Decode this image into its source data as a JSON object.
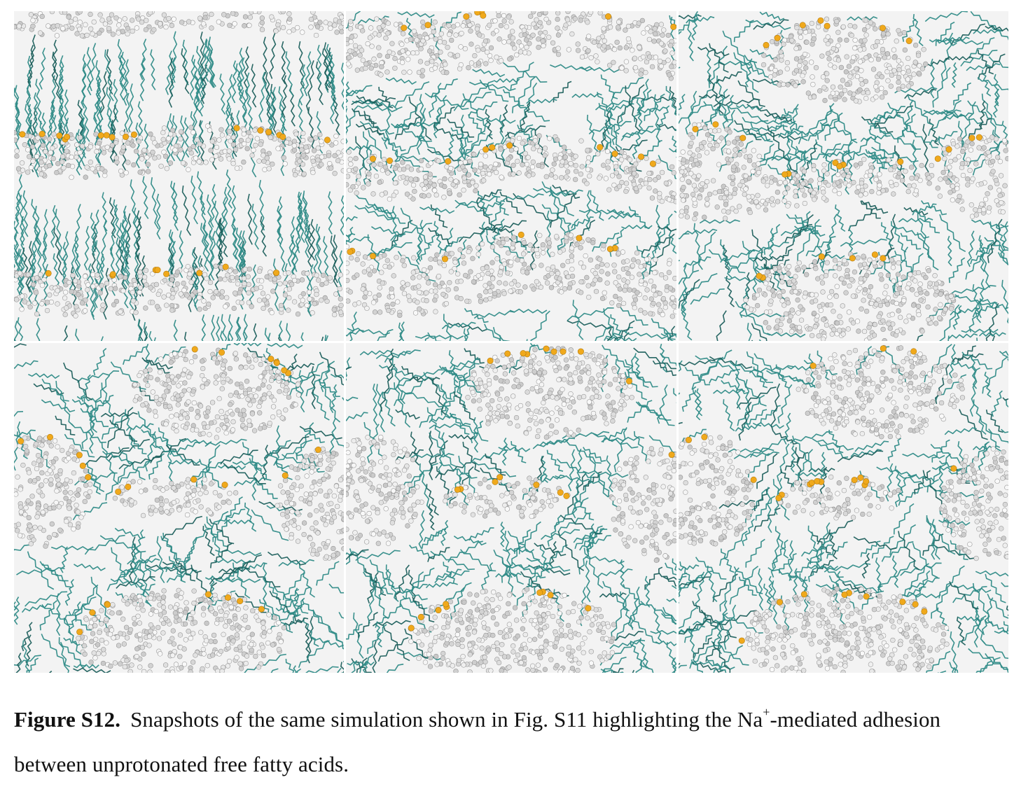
{
  "figure": {
    "panels": [
      {
        "layout": "stacked-bilayers"
      },
      {
        "layout": "undulating-bilayers"
      },
      {
        "layout": "fusing-bilayers"
      },
      {
        "layout": "inverted-micellar"
      },
      {
        "layout": "inverted-micellar"
      },
      {
        "layout": "inverted-micellar"
      }
    ],
    "colors": {
      "tails": "#2f8b87",
      "tails_dark": "#1c5f5c",
      "headgroups": "#e6e6e6",
      "sodium": "#f0a91c",
      "background": "#f3f3f3"
    }
  },
  "caption": {
    "label": "Figure S12.",
    "text_before": "Snapshots of the same simulation shown in Fig. S11 highlighting the Na",
    "superscript": "+",
    "text_after": "-mediated adhesion between unprotonated free fatty acids."
  }
}
